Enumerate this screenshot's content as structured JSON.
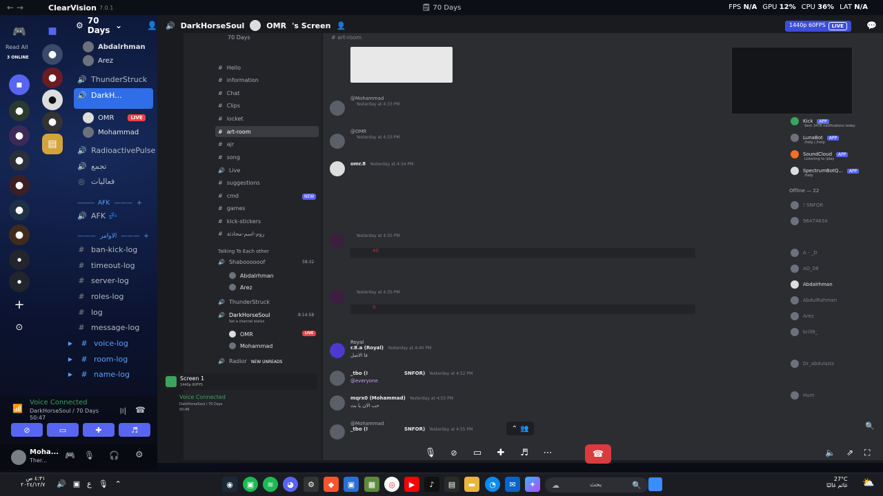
{
  "titlebar": {
    "app_name": "ClearVision",
    "version": "7.0.1",
    "window_title": "70 Days",
    "stats": {
      "fps_label": "FPS",
      "fps_value": "N/A",
      "gpu_label": "GPU",
      "gpu_value": "12%",
      "cpu_label": "CPU",
      "cpu_value": "36%",
      "lat_label": "LAT",
      "lat_value": "N/A"
    }
  },
  "rail": {
    "read_all": "Read All",
    "online": "3 ONLINE"
  },
  "server": {
    "name": "70 Days"
  },
  "sidebar": {
    "top_users": [
      "Abdalrhman",
      "Arez"
    ],
    "channels": [
      {
        "icon": "speaker-icon",
        "label": "ThunderStruck"
      },
      {
        "icon": "speaker-icon",
        "label": "DarkH..."
      }
    ],
    "darkh_users": [
      {
        "label": "OMR",
        "badge": "LIVE"
      },
      {
        "label": "Mohammad"
      }
    ],
    "channels2": [
      {
        "icon": "speaker-icon",
        "label": "RadioactivePulse"
      },
      {
        "icon": "speaker-icon",
        "label": "تجمع"
      },
      {
        "icon": "stage-icon",
        "label": "فعاليات"
      }
    ],
    "cat_afk": "AFK",
    "afk_channel": "AFK 💤",
    "cat_cmds": "الاوامر",
    "log_channels": [
      "ban-kick-log",
      "timeout-log",
      "server-log",
      "roles-log",
      "log",
      "message-log"
    ],
    "link_channels": [
      "voice-log",
      "room-log",
      "name-log"
    ]
  },
  "voice": {
    "status": "Voice Connected",
    "location": "DarkHorseSoul / 70 Days",
    "time": "50:47"
  },
  "user": {
    "name": "Moha...",
    "status": "Ther..."
  },
  "stream": {
    "channel": "DarkHorseSoul",
    "streamer": "OMR",
    "suffix": "'s Screen",
    "quality": "1440p 60FPS",
    "live": "LIVE",
    "inner_server": "70 Days",
    "inner_channels": [
      "Hello",
      "information",
      "Chat",
      "Clips",
      "locket",
      "art-room",
      "ajr",
      "song",
      "Live",
      "suggestions",
      "cmd",
      "games",
      "kick-stickers",
      "روم-اسم-محادثة"
    ],
    "cmd_badge": "NEW",
    "inner_section": "Talking To Each other",
    "inner_voice": [
      "Shaboooooof",
      "ThunderStruck",
      "DarkHorseSoul",
      "Radior"
    ],
    "inner_voice_users": [
      "Abdalrhman",
      "Arez",
      "OMR",
      "Mohammad"
    ],
    "new_unreads": "NEW UNREADS",
    "inner_voice_time_1": "58:32",
    "inner_voice_time_2": "8:14:58",
    "inner_status": "Set a channel status",
    "inner_live": "LIVE",
    "screen_label": "Screen 1",
    "screen_quality": "1440p 60FPS",
    "inner_voice_connected": "Voice Connected",
    "inner_voice_loc": "DarkHorseSoul / 70 Days",
    "inner_voice_time": "50:46",
    "chat_channel": "art-room",
    "messages": [
      {
        "mention": "@Mohammad",
        "time": "Yesterday at 4:33 PM"
      },
      {
        "mention": "@OMR",
        "time": "Yesterday at 4:33 PM"
      },
      {
        "author": "omr.8",
        "time": "Yesterday at 4:34 PM"
      },
      {
        "time": "Yesterday at 4:35 PM",
        "value": "40"
      },
      {
        "time": "Yesterday at 4:35 PM",
        "value": "9"
      },
      {
        "author": "Royal",
        "sub": "r.8.a (Royal)",
        "time": "Yesterday at 4:40 PM",
        "text": "فا الاصل"
      },
      {
        "author": "_tbo (!",
        "author2": "SNFOR)",
        "time": "Yesterday at 4:52 PM",
        "text": "@everyone"
      },
      {
        "author": "mqrx0 (Mohammad)",
        "time": "Yesterday at 4:55 PM",
        "text": "حب الان يا بث"
      },
      {
        "mention": "@Mohammad",
        "author": "_tbo (!",
        "author2": "SNFOR)",
        "time": "Yesterday at 4:55 PM"
      }
    ],
    "members": {
      "apps": [
        {
          "name": "Kick",
          "sub": "Sent 3476 notifications today"
        },
        {
          "name": "LunaBot",
          "sub": "/help | /help"
        },
        {
          "name": "SoundCloud",
          "sub": "Listening to /play"
        },
        {
          "name": "SpectrumBotQ...",
          "sub": "/help"
        }
      ],
      "app_tag": "APP",
      "offline_header": "Offline — 22",
      "offline": [
        "! SNFOR",
        "96474634",
        "A - _D",
        "AO_08",
        "Abdalrhman",
        "AbdulRahman",
        "Arez",
        "brill8_",
        "Dr_abdulaziz",
        "Hum"
      ]
    }
  },
  "taskbar": {
    "time": "٤:٣١ ص",
    "date": "٢٠٢٤/١٢/٧",
    "search": "بحث",
    "weather_temp": "27°C",
    "weather_label": "غائم غالبًا",
    "lang": "ع"
  }
}
